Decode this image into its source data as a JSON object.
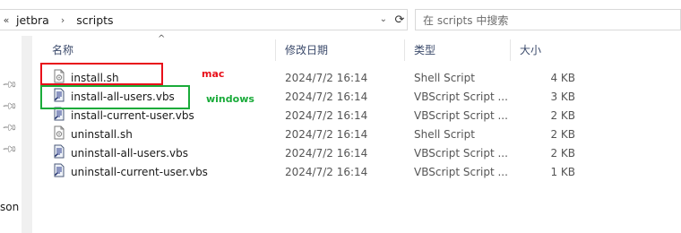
{
  "breadcrumb": {
    "items": [
      "jetbra",
      "scripts"
    ]
  },
  "search": {
    "placeholder": "在 scripts 中搜索"
  },
  "nav": {
    "cut_label": "son"
  },
  "columns": {
    "name": "名称",
    "date": "修改日期",
    "type": "类型",
    "size": "大小"
  },
  "files": [
    {
      "name": "install.sh",
      "date": "2024/7/2 16:14",
      "type": "Shell Script",
      "size": "4 KB",
      "icon": "shell-script-icon"
    },
    {
      "name": "install-all-users.vbs",
      "date": "2024/7/2 16:14",
      "type": "VBScript Script ...",
      "size": "3 KB",
      "icon": "vbscript-icon"
    },
    {
      "name": "install-current-user.vbs",
      "date": "2024/7/2 16:14",
      "type": "VBScript Script ...",
      "size": "2 KB",
      "icon": "vbscript-icon"
    },
    {
      "name": "uninstall.sh",
      "date": "2024/7/2 16:14",
      "type": "Shell Script",
      "size": "2 KB",
      "icon": "shell-script-icon"
    },
    {
      "name": "uninstall-all-users.vbs",
      "date": "2024/7/2 16:14",
      "type": "VBScript Script ...",
      "size": "2 KB",
      "icon": "vbscript-icon"
    },
    {
      "name": "uninstall-current-user.vbs",
      "date": "2024/7/2 16:14",
      "type": "VBScript Script ...",
      "size": "1 KB",
      "icon": "vbscript-icon"
    }
  ],
  "annotations": {
    "mac": "mac",
    "windows": "windows"
  },
  "colors": {
    "annotation_red": "#e8101a",
    "annotation_green": "#1aab3a",
    "header_text": "#3b4a6b"
  }
}
